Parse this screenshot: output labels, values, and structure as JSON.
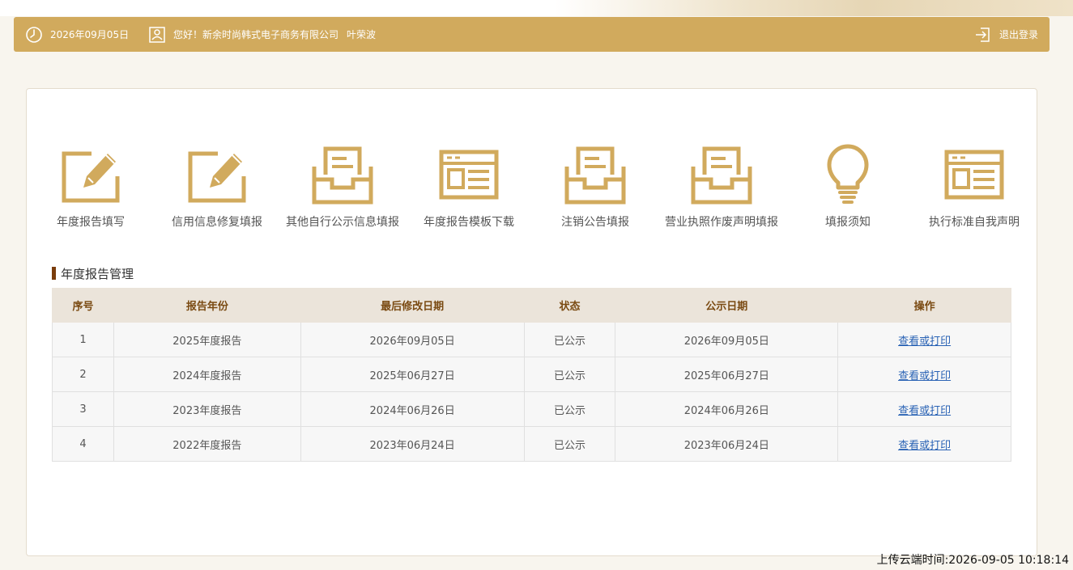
{
  "header": {
    "date": "2026年09月05日",
    "greeting": "您好！新余时尚韩式电子商务有限公司",
    "user": "叶荣波",
    "logout_label": "退出登录",
    "bar_color": "#d1aa5d"
  },
  "tiles": [
    {
      "label": "年度报告填写",
      "icon": "edit-form-icon"
    },
    {
      "label": "信用信息修复填报",
      "icon": "edit-form-icon"
    },
    {
      "label": "其他自行公示信息填报",
      "icon": "document-tray-icon"
    },
    {
      "label": "年度报告模板下载",
      "icon": "template-browser-icon"
    },
    {
      "label": "注销公告填报",
      "icon": "document-tray-icon"
    },
    {
      "label": "营业执照作废声明填报",
      "icon": "document-tray-icon"
    },
    {
      "label": "填报须知",
      "icon": "lightbulb-icon"
    },
    {
      "label": "执行标准自我声明",
      "icon": "template-browser-icon"
    }
  ],
  "section": {
    "title": "年度报告管理"
  },
  "table": {
    "columns": [
      "序号",
      "报告年份",
      "最后修改日期",
      "状态",
      "公示日期",
      "操作"
    ],
    "rows": [
      [
        "1",
        "2025年度报告",
        "2026年09月05日",
        "已公示",
        "2026年09月05日",
        "查看或打印"
      ],
      [
        "2",
        "2024年度报告",
        "2025年06月27日",
        "已公示",
        "2025年06月27日",
        "查看或打印"
      ],
      [
        "3",
        "2023年度报告",
        "2024年06月26日",
        "已公示",
        "2024年06月26日",
        "查看或打印"
      ],
      [
        "4",
        "2022年度报告",
        "2023年06月24日",
        "已公示",
        "2023年06月24日",
        "查看或打印"
      ]
    ]
  },
  "footer": {
    "upload_time": "上传云端时间:2026-09-05 10:18:14"
  },
  "colors": {
    "icon_gold": "#d1aa5d",
    "section_bar": "#7a3d0c",
    "link": "#2a63b5"
  }
}
